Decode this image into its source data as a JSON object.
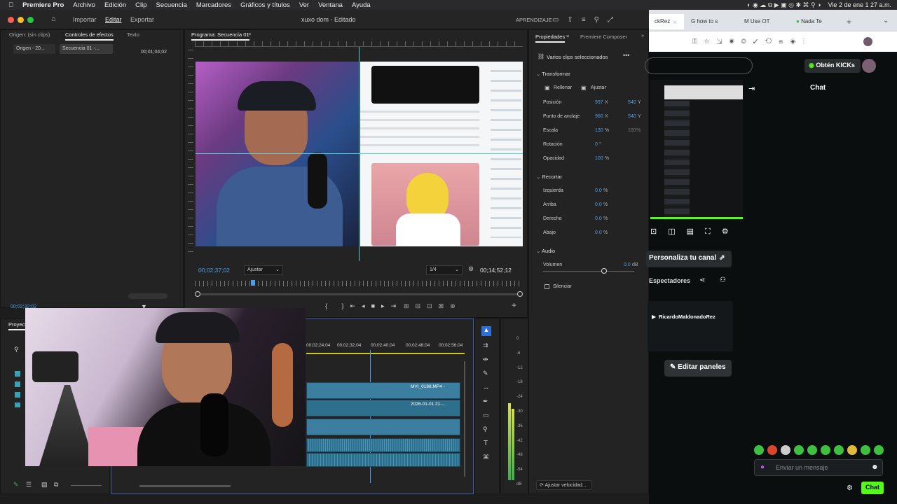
{
  "menubar": {
    "items": [
      "Premiere Pro",
      "Archivo",
      "Edición",
      "Clip",
      "Secuencia",
      "Marcadores",
      "Gráficos y títulos",
      "Ver",
      "Ventana",
      "Ayuda"
    ],
    "datetime": "Vie 2 de ene  1 27 a.m."
  },
  "titlebar": {
    "nav": [
      "Importar",
      "Editar",
      "Exportar"
    ],
    "doc_title": "xuxo dom - Editado",
    "learn": "APRENDIZAJE"
  },
  "source_panel": {
    "tabs": [
      "Origen: (sin clips)",
      "Controles de efectos",
      "Texto"
    ],
    "clip_a": "Origen - 20...",
    "clip_b": "Secuencia 01 -...",
    "timecode": "00;01;04;02",
    "bottom_timecode": "00;02;32;02"
  },
  "program_monitor": {
    "title": "Programa: Secuencia 01",
    "current_tc": "00;02;37;02",
    "fit": "Ajustar",
    "resolution": "1/4",
    "duration_tc": "00;14;52;12"
  },
  "properties": {
    "tabs": [
      "Propiedades",
      "Premiere Composer"
    ],
    "selection": "Varios clips seleccionados",
    "transform_label": "Transformar",
    "fill": "Rellenar",
    "fit": "Ajustar",
    "rows": [
      {
        "label": "Posición",
        "v1": "997",
        "u1": "X",
        "v2": "540",
        "u2": "Y"
      },
      {
        "label": "Punto de anclaje",
        "v1": "960",
        "u1": "X",
        "v2": "540",
        "u2": "Y"
      },
      {
        "label": "Escala",
        "v1": "130",
        "u1": "%",
        "v2": "100",
        "u2": "%"
      },
      {
        "label": "Rotación",
        "v1": "0",
        "u1": "°",
        "v2": "",
        "u2": ""
      },
      {
        "label": "Opacidad",
        "v1": "100",
        "u1": "%",
        "v2": "",
        "u2": ""
      }
    ],
    "crop_label": "Recortar",
    "crop_rows": [
      {
        "label": "Izquierda",
        "v": "0.0",
        "u": "%"
      },
      {
        "label": "Arriba",
        "v": "0.0",
        "u": "%"
      },
      {
        "label": "Derecho",
        "v": "0.0",
        "u": "%"
      },
      {
        "label": "Abajo",
        "v": "0.0",
        "u": "%"
      }
    ],
    "audio_label": "Audio",
    "volume_label": "Volumen",
    "volume_value": "0.0",
    "volume_unit": "dB",
    "mute": "Silenciar",
    "speed_btn": "Ajustar velocidad..."
  },
  "timeline": {
    "ruler": [
      "00;02;24;04",
      "00;02;32;04",
      "00;02;40;04",
      "00;02;48;04",
      "00;02;56;04"
    ],
    "clip_name_1": "MVI_0188.MP4 -",
    "clip_name_2": "2026-01-01 21-...",
    "meter_labels": [
      "0",
      "-6",
      "-12",
      "-18",
      "-24",
      "-30",
      "-36",
      "-42",
      "-48",
      "-54",
      "dB"
    ]
  },
  "project_tab": "Proyecto",
  "chrome": {
    "tabs": [
      "ckRez",
      "how to s",
      "Use OT",
      "Nada Te"
    ]
  },
  "kick": {
    "get_kicks": "Obtén KICKs",
    "chat_title": "Chat",
    "customize": "Personaliza tu canal",
    "viewers": "Espectadores",
    "user": "RicardoMaldonadoRez",
    "edit_panels": "Editar paneles",
    "message_placeholder": "Enviar un mensaje",
    "chat_button": "Chat",
    "accent": "#53fc18"
  }
}
